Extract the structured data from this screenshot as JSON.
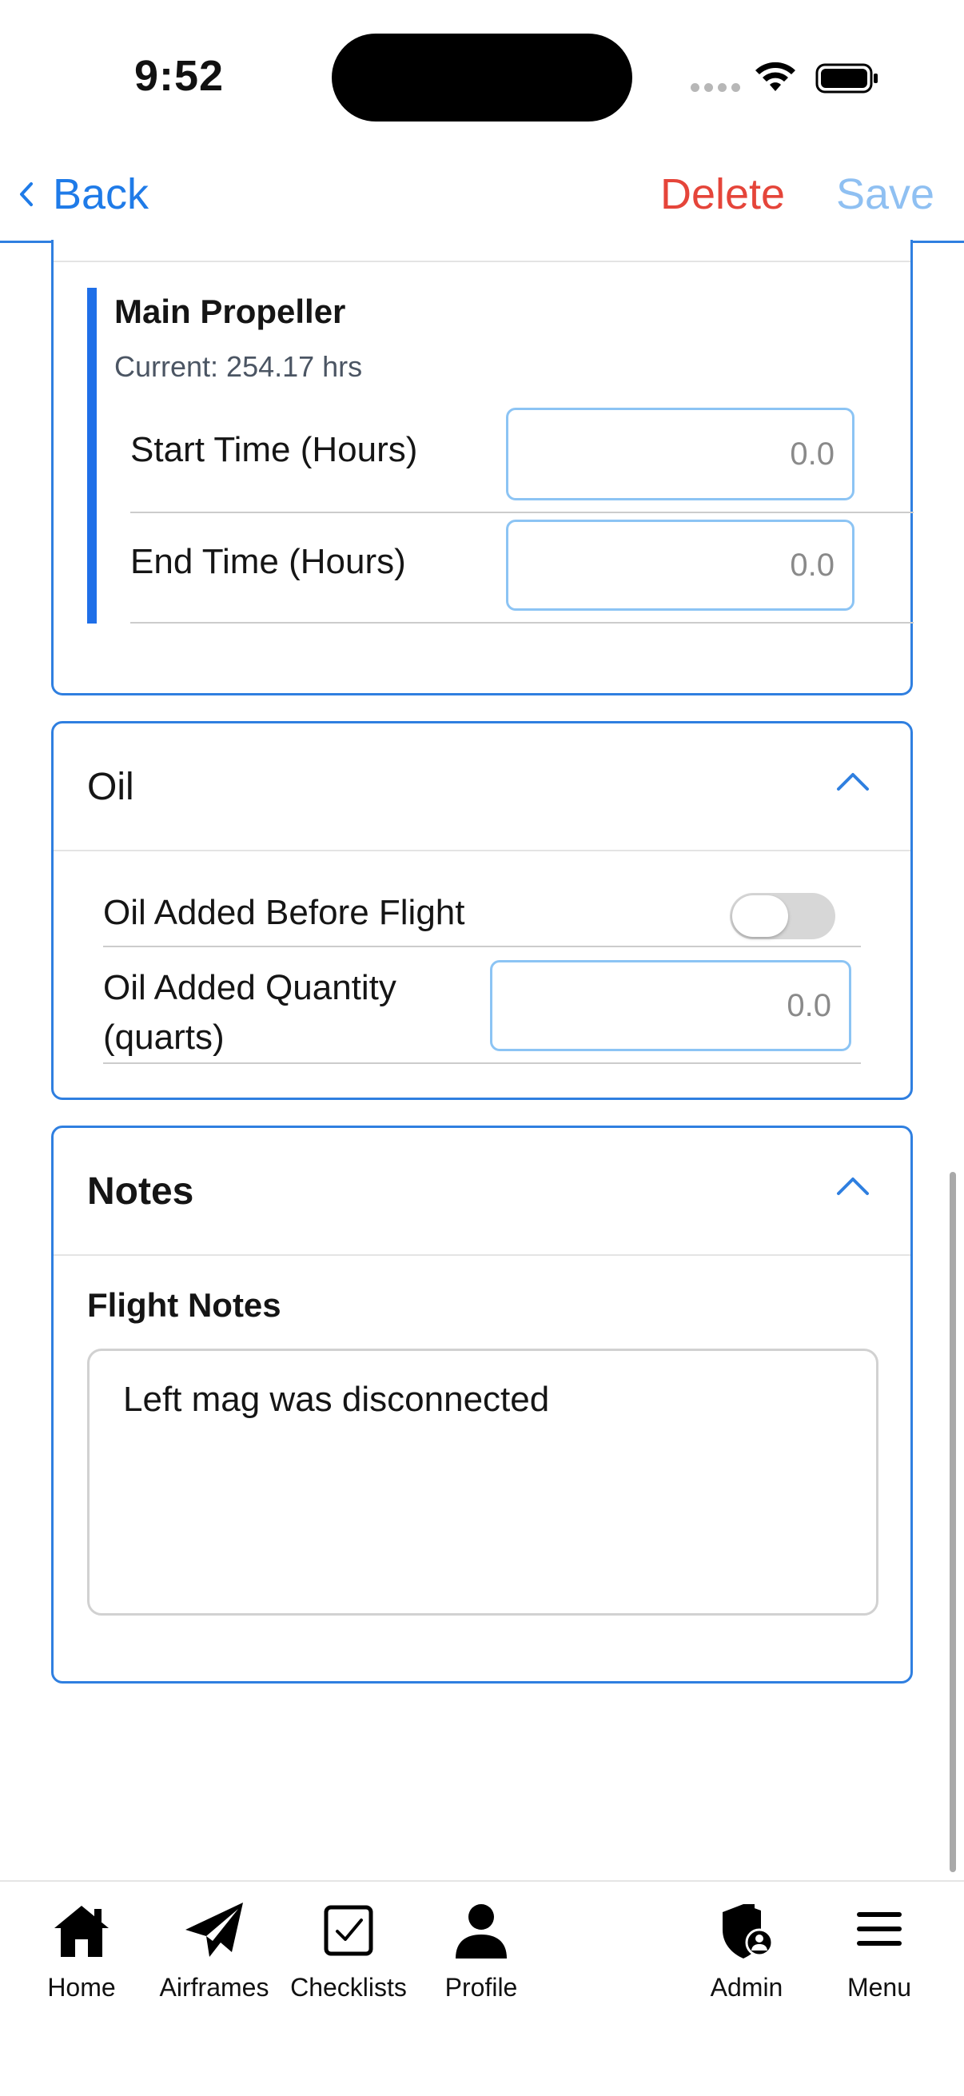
{
  "status_bar": {
    "time": "9:52"
  },
  "nav": {
    "back_label": "Back",
    "delete_label": "Delete",
    "save_label": "Save"
  },
  "propeller": {
    "title": "Main Propeller",
    "current": "Current: 254.17 hrs",
    "start_label": "Start Time (Hours)",
    "start_placeholder": "0.0",
    "end_label": "End Time (Hours)",
    "end_placeholder": "0.0"
  },
  "oil": {
    "title": "Oil",
    "added_before_flight_label": "Oil Added Before Flight",
    "added_before_flight_on": false,
    "quantity_label_line1": "Oil Added Quantity",
    "quantity_label_line2": "(quarts)",
    "quantity_placeholder": "0.0"
  },
  "notes": {
    "title": "Notes",
    "flight_notes_label": "Flight Notes",
    "flight_notes_value": "Left mag was disconnected"
  },
  "tabs": [
    {
      "label": "Home",
      "icon": "home-icon"
    },
    {
      "label": "Airframes",
      "icon": "paper-plane-icon"
    },
    {
      "label": "Checklists",
      "icon": "checkbox-icon"
    },
    {
      "label": "Profile",
      "icon": "person-icon"
    },
    {
      "label": "Admin",
      "icon": "shield-user-icon"
    },
    {
      "label": "Menu",
      "icon": "hamburger-menu-icon"
    }
  ],
  "colors": {
    "accent": "#2f7fe0",
    "delete": "#e5453a",
    "save_disabled": "#8fc0f2",
    "propeller_bar": "#1f6fe8"
  }
}
